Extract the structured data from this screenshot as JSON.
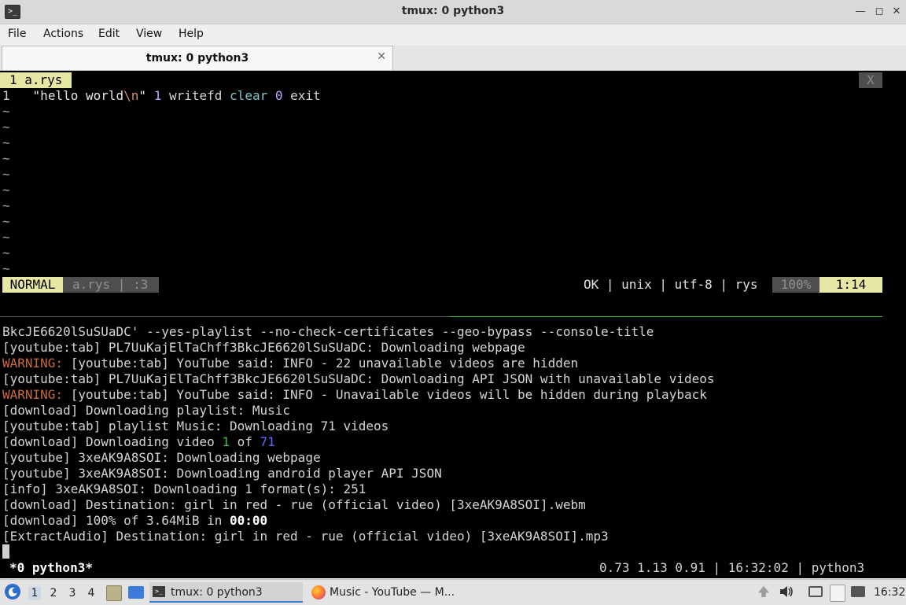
{
  "window": {
    "title": "tmux: 0 python3"
  },
  "menubar": {
    "items": [
      "File",
      "Actions",
      "Edit",
      "View",
      "Help"
    ]
  },
  "tabs": [
    {
      "label": "tmux: 0 python3"
    }
  ],
  "vim": {
    "tab_label": "1 a.rys",
    "close_label": "X",
    "line_number": "1",
    "code": {
      "str_open": "\"hello world",
      "esc": "\\n",
      "str_close": "\"",
      "num1": "1",
      "fn": "writefd",
      "kw": "clear",
      "num2": "0",
      "cmd": "exit"
    },
    "tilde": "~",
    "status": {
      "mode": "NORMAL",
      "file": "a.rys | :3",
      "info": "OK | unix | utf-8 | rys",
      "percent": "100%",
      "position": "1:14"
    }
  },
  "terminal": {
    "line0": "BkcJE6620lSuSUaDC' --yes-playlist --no-check-certificates --geo-bypass --console-title",
    "line1": "[youtube:tab] PL7UuKajElTaChff3BkcJE6620lSuSUaDC: Downloading webpage",
    "line2_warn": "WARNING:",
    "line2_rest": " [youtube:tab] YouTube said: INFO - 22 unavailable videos are hidden",
    "line3": "[youtube:tab] PL7UuKajElTaChff3BkcJE6620lSuSUaDC: Downloading API JSON with unavailable videos",
    "line4_warn": "WARNING:",
    "line4_rest": " [youtube:tab] YouTube said: INFO - Unavailable videos will be hidden during playback",
    "line5": "[download] Downloading playlist: Music",
    "line6": "[youtube:tab] playlist Music: Downloading 71 videos",
    "line7_a": "[download] Downloading video ",
    "line7_b": "1",
    "line7_c": " of ",
    "line7_d": "71",
    "line8": "[youtube] 3xeAK9A8SOI: Downloading webpage",
    "line9": "[youtube] 3xeAK9A8SOI: Downloading android player API JSON",
    "line10": "[info] 3xeAK9A8SOI: Downloading 1 format(s): 251",
    "line11": "[download] Destination: girl in red - rue (official video) [3xeAK9A8SOI].webm",
    "line12_a": "[download] 100% of 3.64MiB in ",
    "line12_b": "00:00",
    "line13": "[ExtractAudio] Destination: girl in red - rue (official video) [3xeAK9A8SOI].mp3"
  },
  "tmux_status": {
    "window": "*0 python3*",
    "right": "0.73 1.13 0.91 | 16:32:02 | python3"
  },
  "taskbar": {
    "workspaces": [
      "1",
      "2",
      "3",
      "4"
    ],
    "tasks": [
      {
        "label": "tmux: 0 python3"
      },
      {
        "label": "Music - YouTube — M..."
      }
    ],
    "clock": "16:32"
  },
  "colors": {
    "vim_accent": "#e6e6a5",
    "warning": "#c86a3b",
    "pane_separator": "#3fbf3f"
  }
}
